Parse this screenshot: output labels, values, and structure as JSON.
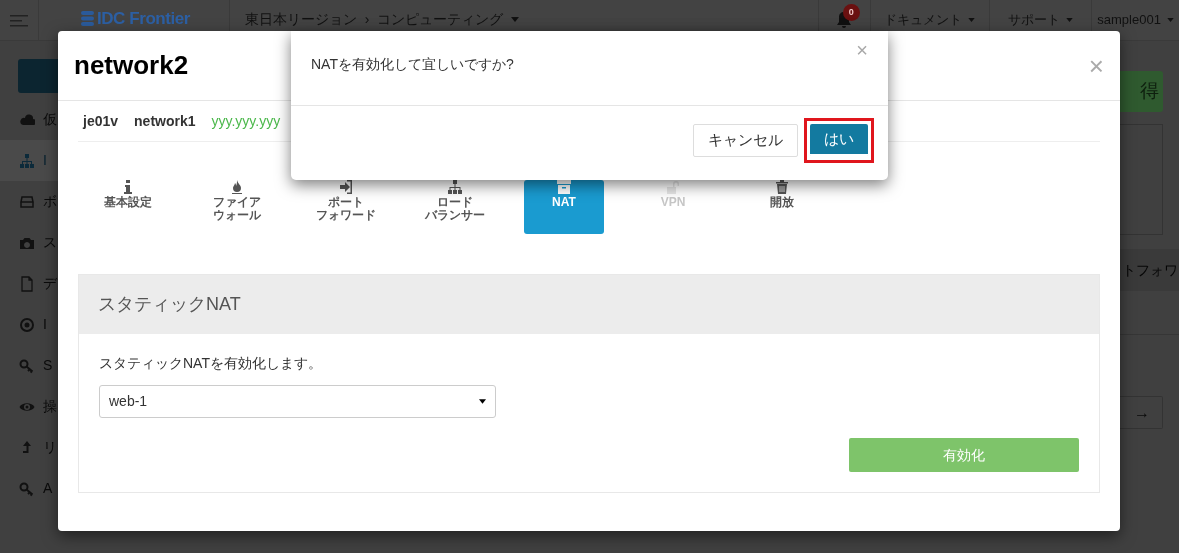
{
  "topbar": {
    "logo": "IDC Frontier",
    "breadcrumb": [
      "東日本リージョン",
      "コンピューティング"
    ],
    "breadcrumb_separator": "›",
    "notification_count": "0",
    "menus": [
      "ドキュメント",
      "サポート",
      "sample001"
    ]
  },
  "sidebar": {
    "items": [
      {
        "label": "仮",
        "selected": false
      },
      {
        "label": "I",
        "selected": true
      },
      {
        "label": "ボ",
        "selected": false
      },
      {
        "label": "ス",
        "selected": false
      },
      {
        "label": "デ",
        "selected": false
      },
      {
        "label": "I",
        "selected": false
      },
      {
        "label": "S",
        "selected": false
      },
      {
        "label": "操",
        "selected": false
      },
      {
        "label": "リ",
        "selected": false
      },
      {
        "label": "A",
        "selected": false
      }
    ]
  },
  "background": {
    "action_button": "得",
    "tab_label": "トフォワ",
    "nav_button": "→"
  },
  "modal": {
    "title": "network2",
    "close": "×",
    "info": [
      {
        "text": "je01v",
        "kind": "name"
      },
      {
        "text": "network1",
        "kind": "name"
      },
      {
        "text": "yyy.yyy.yyy",
        "kind": "address"
      }
    ],
    "tabs": [
      {
        "lines": [
          "基本設定"
        ],
        "selected": false,
        "disabled": false
      },
      {
        "lines": [
          "ファイア",
          "ウォール"
        ],
        "selected": false,
        "disabled": false
      },
      {
        "lines": [
          "ポート",
          "フォワード"
        ],
        "selected": false,
        "disabled": false
      },
      {
        "lines": [
          "ロード",
          "バランサー"
        ],
        "selected": false,
        "disabled": false
      },
      {
        "lines": [
          "NAT"
        ],
        "selected": true,
        "disabled": false
      },
      {
        "lines": [
          "VPN"
        ],
        "selected": false,
        "disabled": true
      },
      {
        "lines": [
          "開放"
        ],
        "selected": false,
        "disabled": false
      }
    ],
    "panel": {
      "title": "スタティックNAT",
      "description": "スタティックNATを有効化します。",
      "select": {
        "value": "web-1"
      },
      "submit": "有効化"
    }
  },
  "dialog": {
    "message": "NATを有効化して宜しいですか?",
    "close": "×",
    "buttons": [
      {
        "label": "キャンセル",
        "kind": "default",
        "highlighted": false
      },
      {
        "label": "はい",
        "kind": "primary",
        "highlighted": true
      }
    ]
  }
}
